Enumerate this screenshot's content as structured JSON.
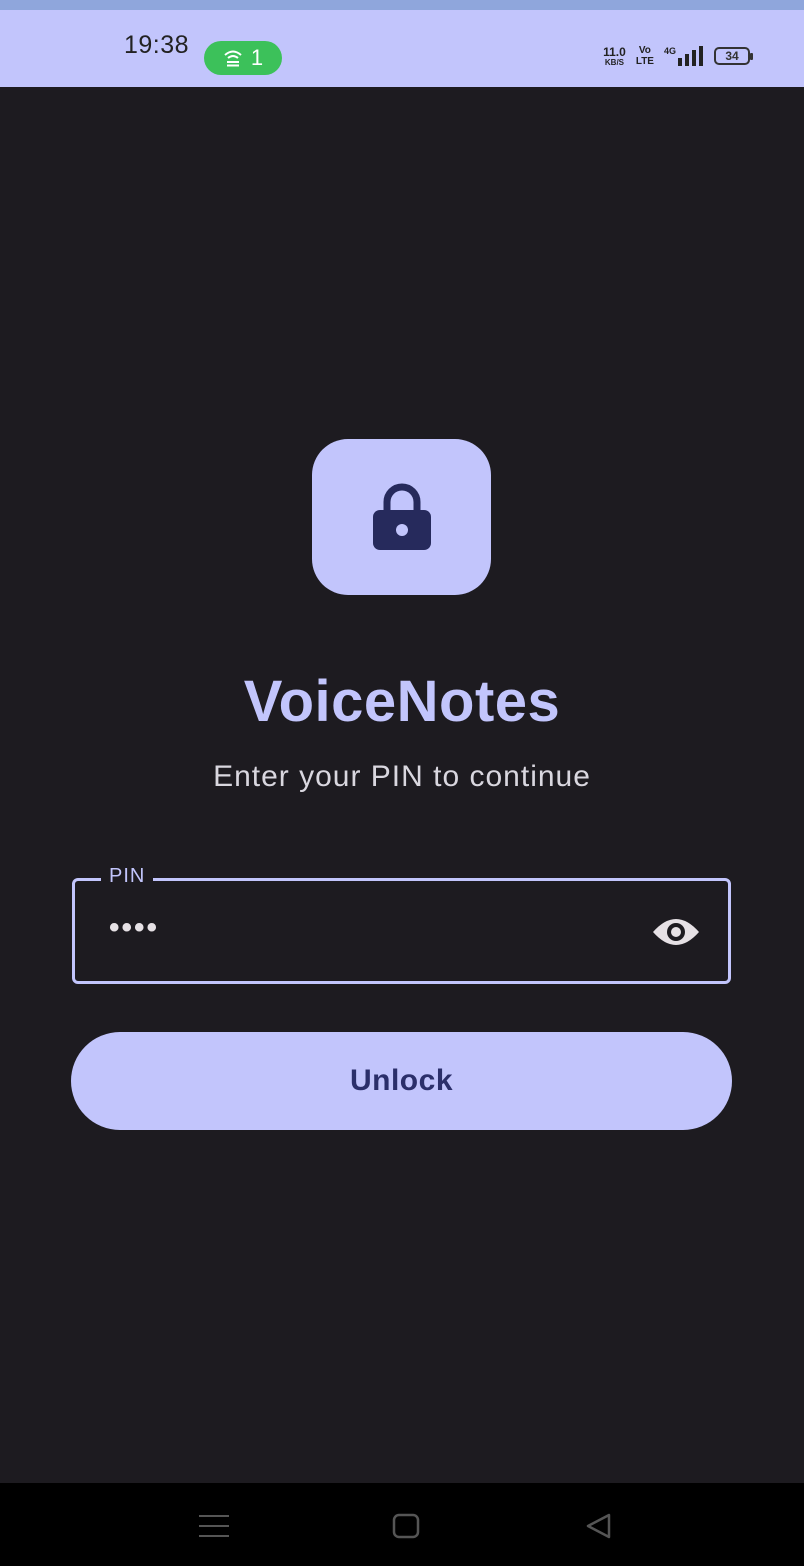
{
  "status_bar": {
    "time": "19:38",
    "hotspot_count": "1",
    "net_speed": "11.0",
    "net_speed_unit": "KB/S",
    "volte_top": "Vo",
    "volte_bottom": "LTE",
    "network_type": "4G",
    "battery": "34"
  },
  "app": {
    "name": "VoiceNotes",
    "subtitle": "Enter your PIN to continue",
    "icon": "lock-icon"
  },
  "pin_field": {
    "label": "PIN",
    "value": "••••",
    "toggle_icon": "eye-icon"
  },
  "unlock_button": {
    "label": "Unlock"
  },
  "nav_bar": {
    "items": [
      "menu-icon",
      "home-icon",
      "back-icon"
    ]
  },
  "colors": {
    "accent": "#c2c5fc",
    "background": "#1d1b20",
    "on_accent": "#2b2f6a",
    "hotspot": "#3cc15a"
  }
}
